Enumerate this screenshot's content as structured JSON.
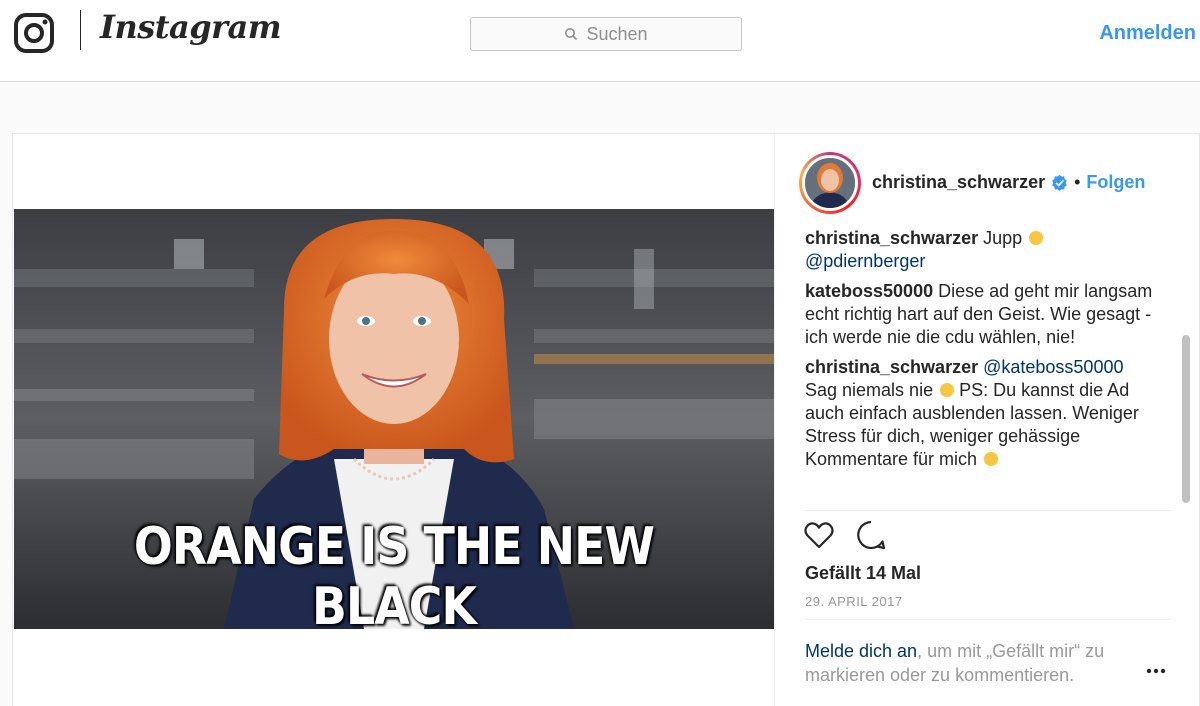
{
  "header": {
    "brand": "Instagram",
    "search_placeholder": "Suchen",
    "login_label": "Anmelden"
  },
  "post": {
    "image_caption": "ORANGE IS THE NEW BLACK",
    "author": "christina_schwarzer",
    "follow_label": "Folgen",
    "comments": [
      {
        "user": "christina_schwarzer",
        "text": " Jupp ",
        "mention": "@pdiernberger"
      },
      {
        "user": "kateboss50000",
        "text": " Diese ad geht mir langsam echt richtig hart auf den Geist. Wie gesagt - ich werde nie die cdu wählen, nie!"
      },
      {
        "user": "christina_schwarzer",
        "mention": "@kateboss50000",
        "text_a": "Sag niemals nie",
        "text_b": "  PS: Du kannst die Ad auch einfach ausblenden lassen. Weniger Stress für dich, weniger gehässige Kommentare für mich"
      }
    ],
    "likes": "Gefällt 14 Mal",
    "date": "29. APRIL 2017",
    "login_prompt_link": "Melde dich an",
    "login_prompt_text": ", um mit „Gefällt mir“ zu markieren oder zu kommentieren."
  },
  "colors": {
    "accent": "#3897f0",
    "mention": "#003569",
    "verified": "#3897f0"
  },
  "icons": [
    "instagram-logo-icon",
    "search-icon",
    "verified-icon",
    "heart-icon",
    "comment-icon",
    "more-icon"
  ]
}
